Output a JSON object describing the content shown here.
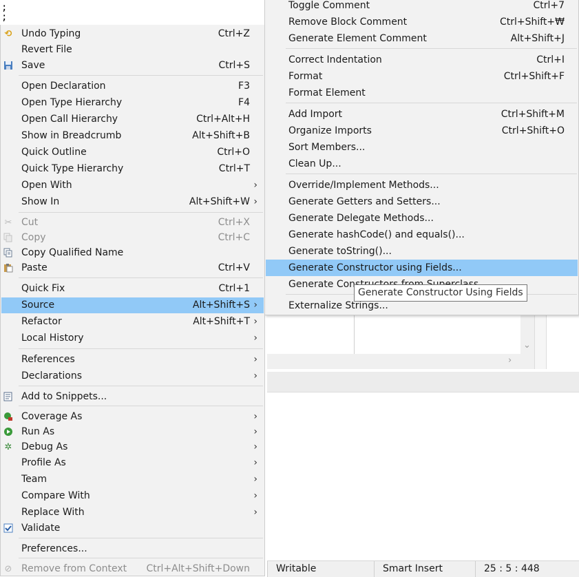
{
  "editor": {
    "visible_text": ";"
  },
  "context_menu": {
    "items": [
      {
        "icon": "undo-icon",
        "label": "Undo Typing",
        "shortcut": "Ctrl+Z"
      },
      {
        "icon": "",
        "label": "Revert File",
        "shortcut": ""
      },
      {
        "icon": "save-icon",
        "label": "Save",
        "shortcut": "Ctrl+S"
      },
      {
        "icon": "",
        "label": "Open Declaration",
        "shortcut": "F3"
      },
      {
        "icon": "",
        "label": "Open Type Hierarchy",
        "shortcut": "F4"
      },
      {
        "icon": "",
        "label": "Open Call Hierarchy",
        "shortcut": "Ctrl+Alt+H"
      },
      {
        "icon": "",
        "label": "Show in Breadcrumb",
        "shortcut": "Alt+Shift+B"
      },
      {
        "icon": "",
        "label": "Quick Outline",
        "shortcut": "Ctrl+O"
      },
      {
        "icon": "",
        "label": "Quick Type Hierarchy",
        "shortcut": "Ctrl+T"
      },
      {
        "icon": "",
        "label": "Open With",
        "shortcut": "",
        "submenu": true
      },
      {
        "icon": "",
        "label": "Show In",
        "shortcut": "Alt+Shift+W",
        "submenu": true
      },
      {
        "icon": "cut-icon",
        "label": "Cut",
        "shortcut": "Ctrl+X",
        "disabled": true
      },
      {
        "icon": "copy-icon",
        "label": "Copy",
        "shortcut": "Ctrl+C",
        "disabled": true
      },
      {
        "icon": "copy-qualified-name-icon",
        "label": "Copy Qualified Name",
        "shortcut": ""
      },
      {
        "icon": "paste-icon",
        "label": "Paste",
        "shortcut": "Ctrl+V"
      },
      {
        "icon": "",
        "label": "Quick Fix",
        "shortcut": "Ctrl+1"
      },
      {
        "icon": "",
        "label": "Source",
        "shortcut": "Alt+Shift+S",
        "submenu": true,
        "highlighted": true
      },
      {
        "icon": "",
        "label": "Refactor",
        "shortcut": "Alt+Shift+T",
        "submenu": true
      },
      {
        "icon": "",
        "label": "Local History",
        "shortcut": "",
        "submenu": true
      },
      {
        "icon": "",
        "label": "References",
        "shortcut": "",
        "submenu": true
      },
      {
        "icon": "",
        "label": "Declarations",
        "shortcut": "",
        "submenu": true
      },
      {
        "icon": "snippets-icon",
        "label": "Add to Snippets...",
        "shortcut": ""
      },
      {
        "icon": "coverage-icon",
        "label": "Coverage As",
        "shortcut": "",
        "submenu": true
      },
      {
        "icon": "run-icon",
        "label": "Run As",
        "shortcut": "",
        "submenu": true
      },
      {
        "icon": "debug-icon",
        "label": "Debug As",
        "shortcut": "",
        "submenu": true
      },
      {
        "icon": "",
        "label": "Profile As",
        "shortcut": "",
        "submenu": true
      },
      {
        "icon": "",
        "label": "Team",
        "shortcut": "",
        "submenu": true
      },
      {
        "icon": "",
        "label": "Compare With",
        "shortcut": "",
        "submenu": true
      },
      {
        "icon": "",
        "label": "Replace With",
        "shortcut": "",
        "submenu": true
      },
      {
        "icon": "checkbox-icon",
        "label": "Validate",
        "shortcut": ""
      },
      {
        "icon": "",
        "label": "Preferences...",
        "shortcut": ""
      },
      {
        "icon": "remove-context-icon",
        "label": "Remove from Context",
        "shortcut": "Ctrl+Alt+Shift+Down",
        "disabled": true
      }
    ]
  },
  "source_submenu": {
    "items": [
      {
        "label": "Toggle Comment",
        "shortcut": "Ctrl+7"
      },
      {
        "label": "Remove Block Comment",
        "shortcut": "Ctrl+Shift+₩"
      },
      {
        "label": "Generate Element Comment",
        "shortcut": "Alt+Shift+J"
      },
      {
        "label": "Correct Indentation",
        "shortcut": "Ctrl+I"
      },
      {
        "label": "Format",
        "shortcut": "Ctrl+Shift+F"
      },
      {
        "label": "Format Element",
        "shortcut": ""
      },
      {
        "label": "Add Import",
        "shortcut": "Ctrl+Shift+M"
      },
      {
        "label": "Organize Imports",
        "shortcut": "Ctrl+Shift+O"
      },
      {
        "label": "Sort Members...",
        "shortcut": ""
      },
      {
        "label": "Clean Up...",
        "shortcut": ""
      },
      {
        "label": "Override/Implement Methods...",
        "shortcut": ""
      },
      {
        "label": "Generate Getters and Setters...",
        "shortcut": ""
      },
      {
        "label": "Generate Delegate Methods...",
        "shortcut": ""
      },
      {
        "label": "Generate hashCode() and equals()...",
        "shortcut": ""
      },
      {
        "label": "Generate toString()...",
        "shortcut": ""
      },
      {
        "label": "Generate Constructor using Fields...",
        "shortcut": "",
        "highlighted": true
      },
      {
        "label": "Generate Constructors from Superclass...",
        "shortcut": ""
      },
      {
        "label": "Externalize Strings...",
        "shortcut": ""
      }
    ]
  },
  "tooltip": {
    "text": "Generate Constructor Using Fields"
  },
  "status_bar": {
    "writable": "Writable",
    "insert_mode": "Smart Insert",
    "position": "25 : 5 : 448"
  },
  "colors": {
    "menu_bg": "#f2f2f2",
    "highlight": "#91c9f7",
    "disabled_text": "#8d8d8d"
  }
}
